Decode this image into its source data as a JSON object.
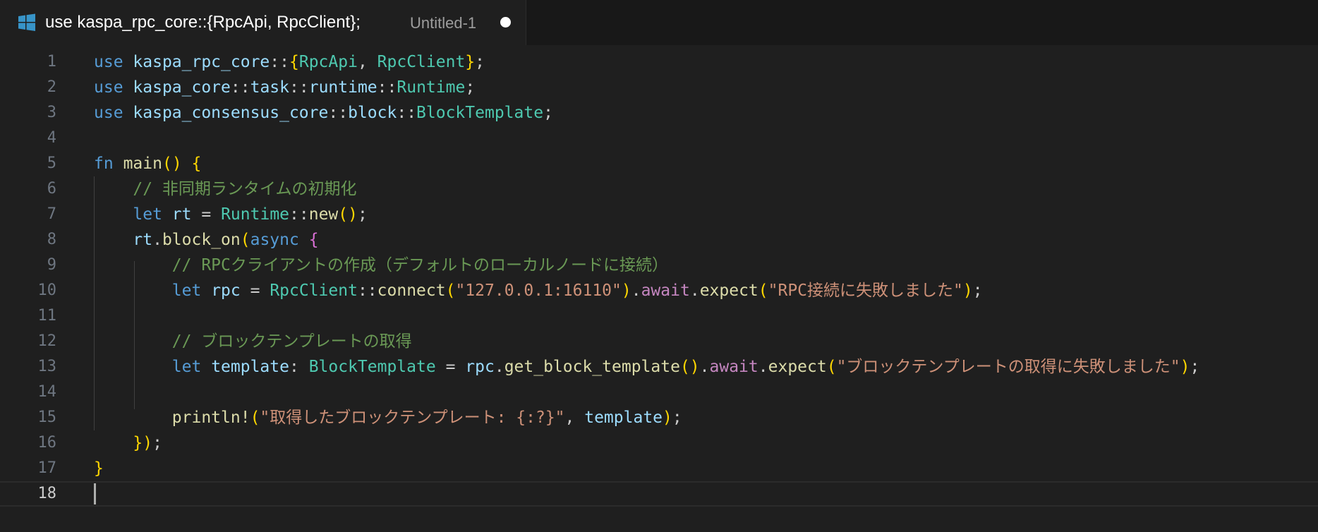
{
  "tab": {
    "title": "use kaspa_rpc_core::{RpcApi, RpcClient};",
    "description": "Untitled-1",
    "icon": "windows-logo-icon",
    "dirty_indicator": "modified-dot-icon"
  },
  "colors": {
    "editor_background": "#1f1f1f",
    "tabbar_background": "#181818",
    "line_number": "#6e7681",
    "active_line_number": "#cccccc"
  },
  "editor": {
    "active_line": 18,
    "language": "rust",
    "lines": [
      {
        "number": "1",
        "text": "use kaspa_rpc_core::{RpcApi, RpcClient};"
      },
      {
        "number": "2",
        "text": "use kaspa_core::task::runtime::Runtime;"
      },
      {
        "number": "3",
        "text": "use kaspa_consensus_core::block::BlockTemplate;"
      },
      {
        "number": "4",
        "text": ""
      },
      {
        "number": "5",
        "text": "fn main() {"
      },
      {
        "number": "6",
        "text": "    // 非同期ランタイムの初期化"
      },
      {
        "number": "7",
        "text": "    let rt = Runtime::new();"
      },
      {
        "number": "8",
        "text": "    rt.block_on(async {"
      },
      {
        "number": "9",
        "text": "        // RPCクライアントの作成（デフォルトのローカルノードに接続）"
      },
      {
        "number": "10",
        "text": "        let rpc = RpcClient::connect(\"127.0.0.1:16110\").await.expect(\"RPC接続に失敗しました\");"
      },
      {
        "number": "11",
        "text": ""
      },
      {
        "number": "12",
        "text": "        // ブロックテンプレートの取得"
      },
      {
        "number": "13",
        "text": "        let template: BlockTemplate = rpc.get_block_template().await.expect(\"ブロックテンプレートの取得に失敗しました\");"
      },
      {
        "number": "14",
        "text": ""
      },
      {
        "number": "15",
        "text": "        println!(\"取得したブロックテンプレート: {:?}\", template);"
      },
      {
        "number": "16",
        "text": "    });"
      },
      {
        "number": "17",
        "text": "}"
      },
      {
        "number": "18",
        "text": ""
      }
    ]
  }
}
